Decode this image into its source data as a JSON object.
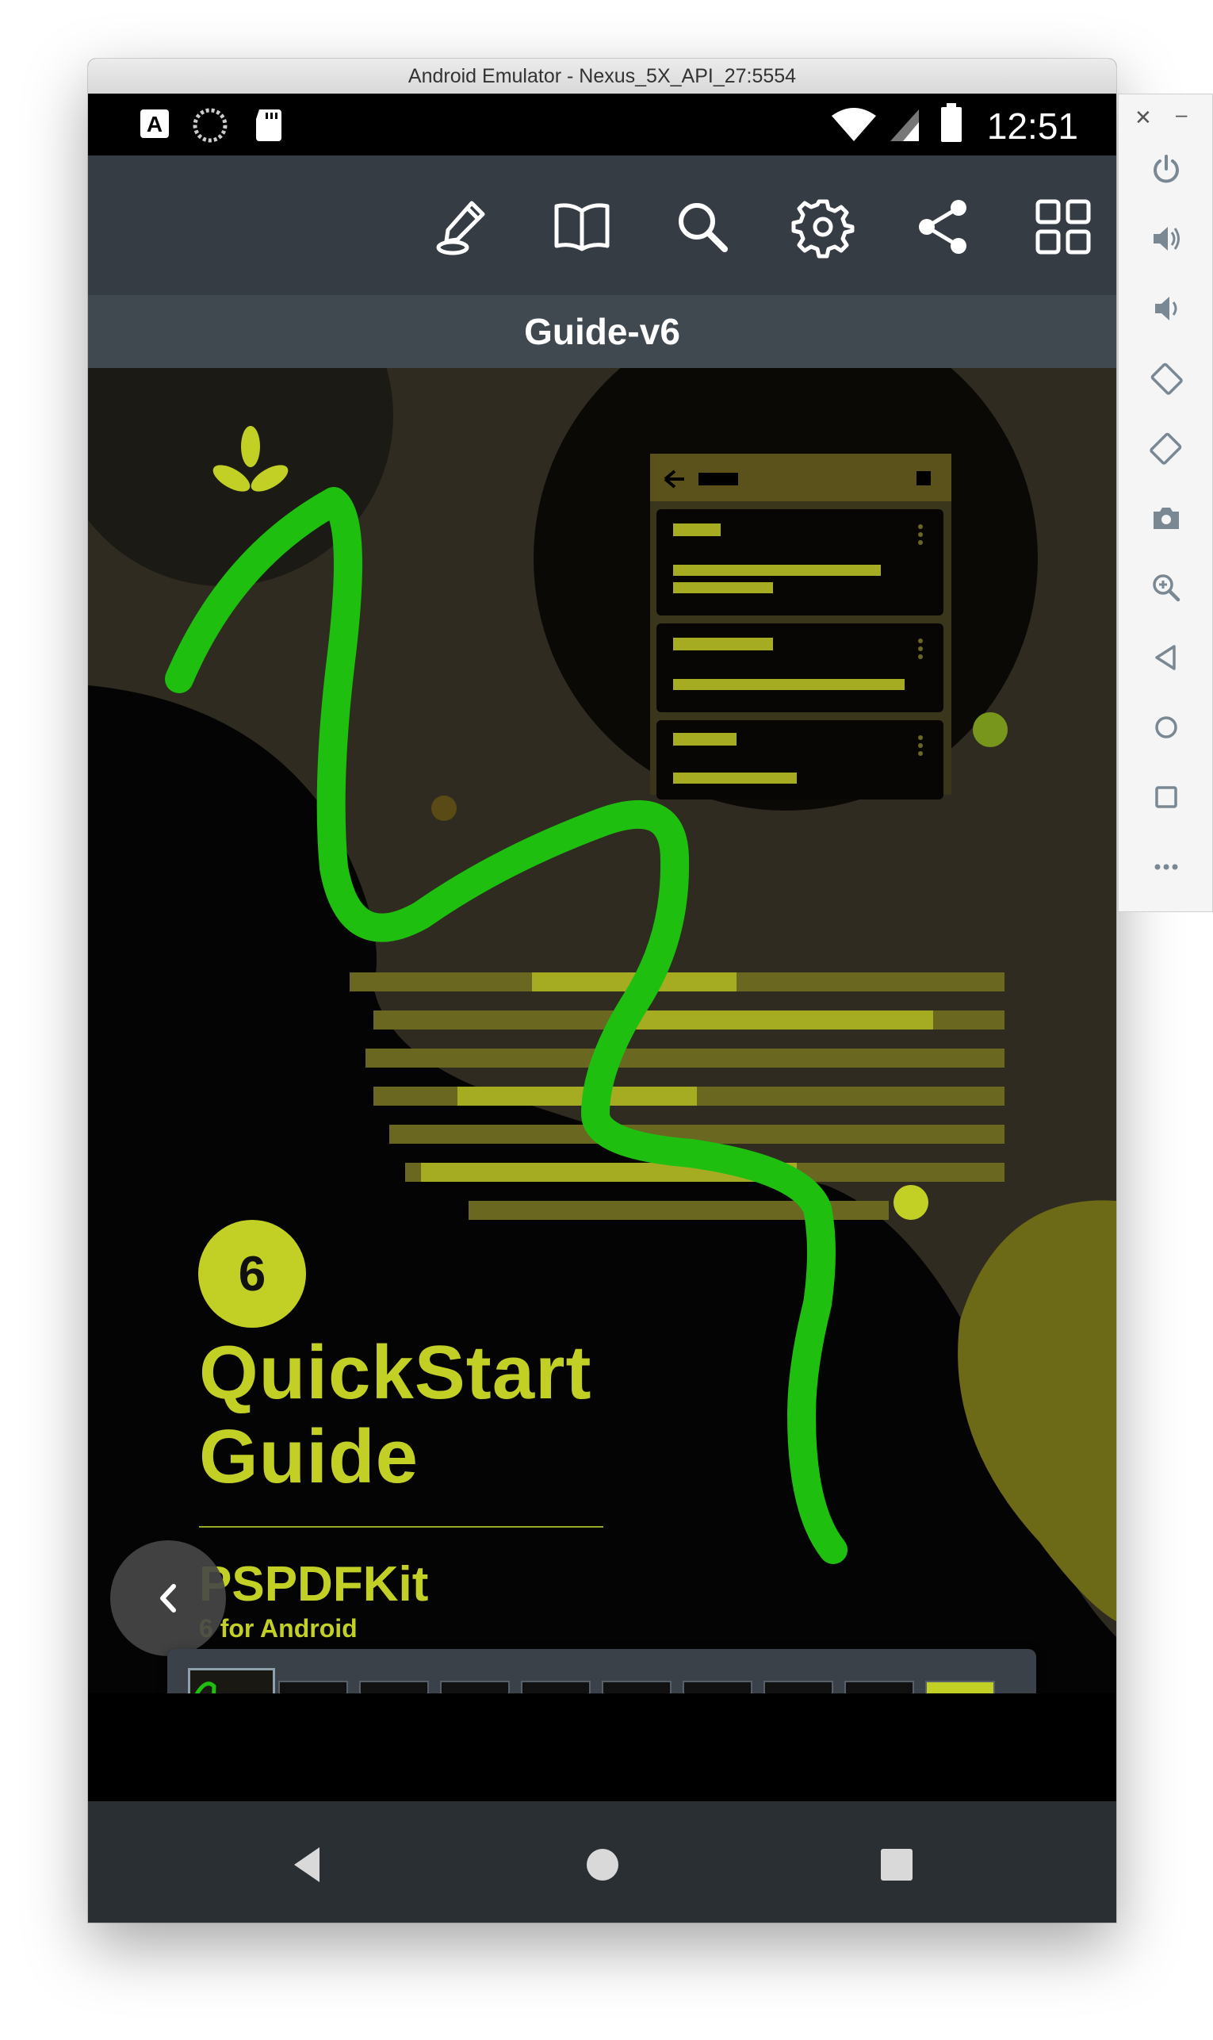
{
  "window": {
    "title": "Android Emulator - Nexus_5X_API_27:5554"
  },
  "status_bar": {
    "time": "12:51"
  },
  "toolbar": {
    "buttons": [
      {
        "name": "annotate-pen-icon"
      },
      {
        "name": "reader-view-book-icon"
      },
      {
        "name": "search-icon"
      },
      {
        "name": "settings-gear-icon"
      },
      {
        "name": "share-icon"
      },
      {
        "name": "grid-view-icon"
      }
    ]
  },
  "document": {
    "title": "Guide-v6",
    "cover": {
      "badge": "6",
      "title": "QuickStart\nGuide",
      "brand": "PSPDFKit",
      "subtitle": "6 for Android"
    },
    "page_count_thumbnails": 10,
    "selected_thumbnail": 1
  },
  "colors": {
    "accent": "#c2d025",
    "ink_annotation": "#1fbf10",
    "toolbar": "#353c44",
    "doc_title_bar": "#414950",
    "page_background_dark": "#2f2b20"
  },
  "side_panel": {
    "buttons": [
      "power-icon",
      "volume-up-icon",
      "volume-down-icon",
      "rotate-left-icon",
      "rotate-right-icon",
      "camera-icon",
      "zoom-icon",
      "back-icon",
      "home-icon",
      "overview-icon",
      "more-icon"
    ]
  }
}
